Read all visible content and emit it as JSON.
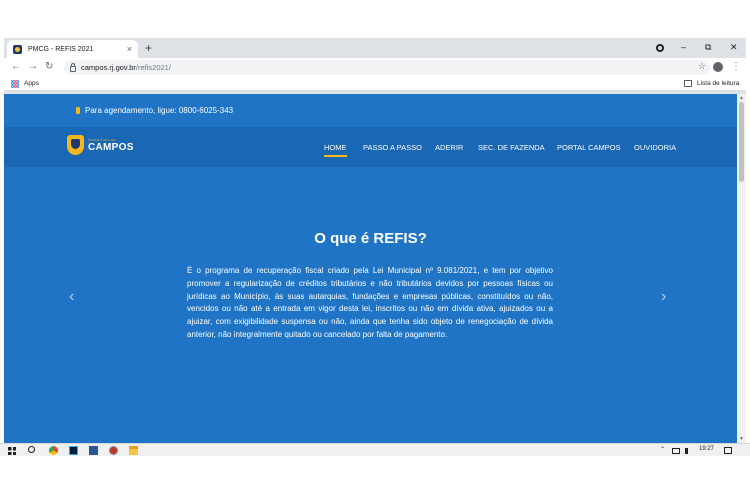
{
  "browser": {
    "tab_title": "PMCG - REFIS 2021",
    "tab_close": "×",
    "new_tab": "+",
    "url_host": "campos.rj.gov.br",
    "url_path": "/refis2021/",
    "bookmarks": {
      "apps_label": "Apps",
      "reading_list": "Lista de leitura"
    },
    "window_controls": {
      "minimize": "–",
      "maximize": "⧉",
      "close": "✕"
    },
    "nav": {
      "back": "←",
      "forward": "→",
      "reload": "↻",
      "star": "☆",
      "menu": "⋮"
    }
  },
  "site": {
    "phone_text": "Para agendamento, ligue: 0800-6025-343",
    "logo": {
      "sub": "PREFEITURA DE",
      "main": "CAMPOS"
    },
    "nav_items": [
      "HOME",
      "PASSO A PASSO",
      "ADERIR",
      "SEC. DE FAZENDA",
      "PORTAL CAMPOS",
      "OUVIDORIA"
    ],
    "accent_color": "#f6b818",
    "background_color": "#1f74c6"
  },
  "slide": {
    "title": "O que é REFIS?",
    "body": "É o programa de recuperação fiscal criado pela Lei Municipal nº 9.081/2021, e tem por objetivo promover a regularização de créditos tributários e não tributários devidos por pessoas físicas ou jurídicas ao Município, às suas autarquias, fundações e empresas públicas, constituídos ou não, vencidos ou não até a entrada em vigor desta lei, inscritos ou não em dívida ativa, ajuizados ou a ajuizar, com exigibilidade suspensa ou não, ainda que tenha sido objeto de renegociação de dívida anterior, não integralmente quitado ou cancelado por falta de pagamento.",
    "prev_arrow": "‹",
    "next_arrow": "›"
  },
  "taskbar": {
    "tray": "⌃",
    "time": "19:27"
  }
}
